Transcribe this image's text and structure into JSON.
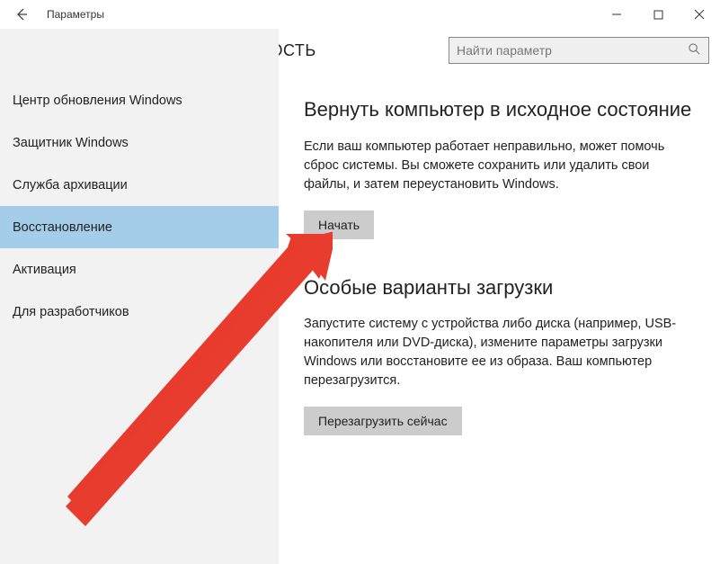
{
  "titlebar": {
    "title": "Параметры"
  },
  "header": {
    "title": "ОБНОВЛЕНИЕ И БЕЗОПАСНОСТЬ"
  },
  "search": {
    "placeholder": "Найти параметр"
  },
  "sidebar": {
    "items": [
      {
        "label": "Центр обновления Windows"
      },
      {
        "label": "Защитник Windows"
      },
      {
        "label": "Служба архивации"
      },
      {
        "label": "Восстановление"
      },
      {
        "label": "Активация"
      },
      {
        "label": "Для разработчиков"
      }
    ],
    "selectedIndex": 3
  },
  "main": {
    "section1": {
      "heading": "Вернуть компьютер в исходное состояние",
      "body": "Если ваш компьютер работает неправильно, может помочь сброс системы. Вы сможете сохранить или удалить свои файлы, и затем переустановить Windows.",
      "button": "Начать"
    },
    "section2": {
      "heading": "Особые варианты загрузки",
      "body": "Запустите систему с устройства либо диска (например, USB-накопителя или DVD-диска), измените параметры загрузки Windows или восстановите ее из образа. Ваш компьютер перезагрузится.",
      "button": "Перезагрузить сейчас"
    }
  }
}
